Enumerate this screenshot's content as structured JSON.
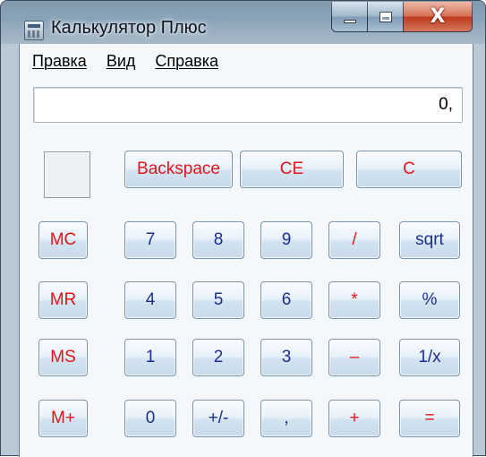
{
  "window": {
    "title": "Калькулятор Плюс",
    "icon": "calculator-app-icon"
  },
  "caption_buttons": {
    "minimize": "minimize-icon",
    "maximize": "maximize-icon",
    "close": "close-icon",
    "close_glyph": "X"
  },
  "menu": [
    "Правка",
    "Вид",
    "Справка"
  ],
  "display": {
    "value": "0,"
  },
  "colors": {
    "digit_text": "#1c2f8c",
    "operator_text": "#e0161b",
    "button_face": "#d2e2f0",
    "window_frame": "#b9c9d6"
  },
  "buttons": {
    "backspace": "Backspace",
    "ce": "CE",
    "c": "C",
    "mc": "MC",
    "mr": "MR",
    "ms": "MS",
    "mplus": "M+",
    "d7": "7",
    "d8": "8",
    "d9": "9",
    "d4": "4",
    "d5": "5",
    "d6": "6",
    "d1": "1",
    "d2": "2",
    "d3": "3",
    "d0": "0",
    "sign": "+/-",
    "decimal": ",",
    "divide": "/",
    "multiply": "*",
    "subtract": "–",
    "add": "+",
    "equals": "=",
    "sqrt": "sqrt",
    "percent": "%",
    "reciprocal": "1/x"
  }
}
